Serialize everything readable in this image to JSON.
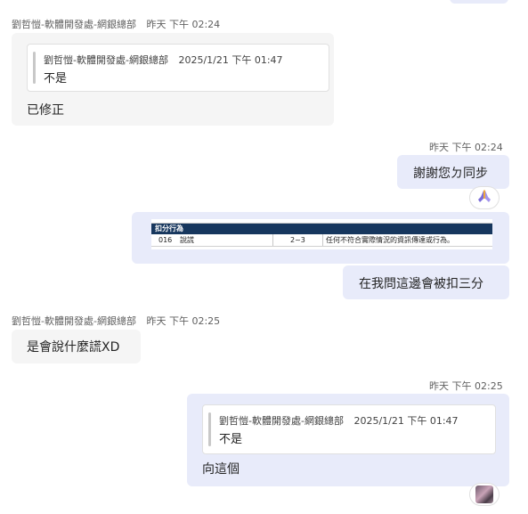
{
  "colors": {
    "incoming_bubble": "#f5f5f5",
    "outgoing_bubble": "#e8ebfa",
    "table_header": "#17375e"
  },
  "messages": {
    "m1": {
      "sender": "劉哲愷-軟體開發處-網銀總部",
      "time": "昨天 下午 02:24",
      "quote": {
        "author": "劉哲愷-軟體開發處-網銀總部",
        "time": "2025/1/21 下午 01:47",
        "text": "不是"
      },
      "text": "已修正"
    },
    "m2": {
      "time": "昨天 下午 02:24",
      "text": "謝謝您ㄉ同步",
      "reaction_icon": "folded-hands-icon"
    },
    "m3": {
      "image": {
        "header": "扣分行為",
        "row": {
          "code": "016",
          "name": "說謊",
          "points": "2~3",
          "desc": "任何不符合實際情況的資訊傳達或行為。"
        }
      }
    },
    "m4": {
      "text": "在我問這邊會被扣三分"
    },
    "m5": {
      "sender": "劉哲愷-軟體開發處-網銀總部",
      "time": "昨天 下午 02:25",
      "text": "是會說什麼謊XD"
    },
    "m6": {
      "time": "昨天 下午 02:25",
      "quote": {
        "author": "劉哲愷-軟體開發處-網銀總部",
        "time": "2025/1/21 下午 01:47",
        "text": "不是"
      },
      "text": "向這個"
    }
  }
}
